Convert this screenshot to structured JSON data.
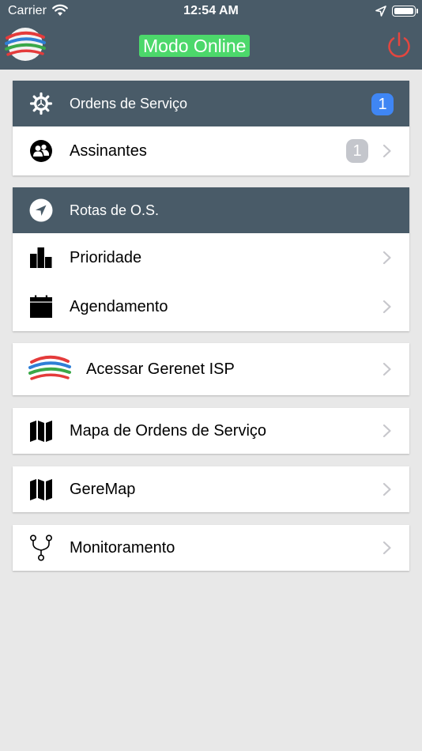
{
  "status_bar": {
    "carrier": "Carrier",
    "time": "12:54 AM"
  },
  "navbar": {
    "title": "Modo Online",
    "title_bg_color": "#4cd86b",
    "bar_color": "#495b68",
    "power_color": "#e4463f"
  },
  "service_orders": {
    "header": "Ordens de Serviço",
    "header_badge": "1",
    "subscribers_label": "Assinantes",
    "subscribers_badge": "1"
  },
  "routes": {
    "header": "Rotas de O.S.",
    "priority_label": "Prioridade",
    "schedule_label": "Agendamento"
  },
  "menu": {
    "gerenet_label": "Acessar Gerenet ISP",
    "map_orders_label": "Mapa de Ordens de Serviço",
    "geremap_label": "GereMap",
    "monitoring_label": "Monitoramento"
  },
  "icons": {
    "app_logo": "gerenet-logo-icon",
    "power": "power-icon",
    "gear": "gear-icon",
    "users": "users-icon",
    "navigation": "navigation-arrow-icon",
    "bar_chart": "bar-chart-icon",
    "calendar": "calendar-icon",
    "map": "map-icon",
    "network": "network-branch-icon",
    "chevron": "chevron-right-icon"
  }
}
